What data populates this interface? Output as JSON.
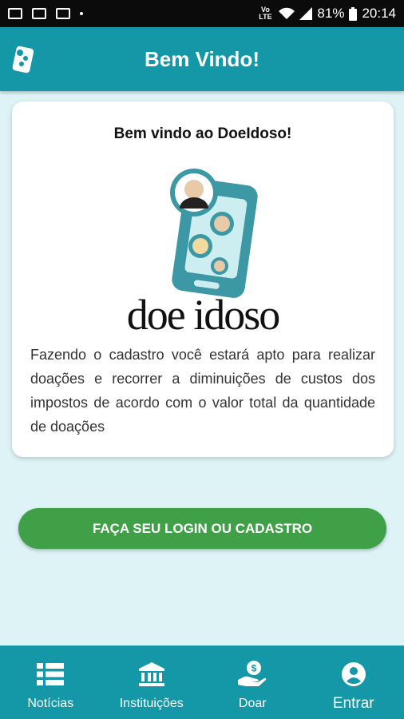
{
  "status_bar": {
    "battery": "81%",
    "time": "20:14",
    "network": "Vo LTE"
  },
  "app_bar": {
    "title": "Bem Vindo!"
  },
  "card": {
    "title": "Bem vindo ao DoeIdoso!",
    "brand": "doe idoso",
    "description": "Fazendo o cadastro você estará apto para realizar doações e recorrer a diminuições de custos dos impostos de acordo com o valor total da quantidade de doações"
  },
  "login_button": {
    "label": "FAÇA SEU LOGIN OU CADASTRO"
  },
  "bottom_nav": {
    "items": [
      {
        "label": "Notícias",
        "icon": "list-icon"
      },
      {
        "label": "Instituições",
        "icon": "bank-icon"
      },
      {
        "label": "Doar",
        "icon": "donate-hand-icon"
      },
      {
        "label": "Entrar",
        "icon": "account-circle-icon"
      }
    ]
  },
  "colors": {
    "primary": "#1497a6",
    "background": "#ddf3f6",
    "button": "#3fa047",
    "illustration": "#3d98a6"
  }
}
